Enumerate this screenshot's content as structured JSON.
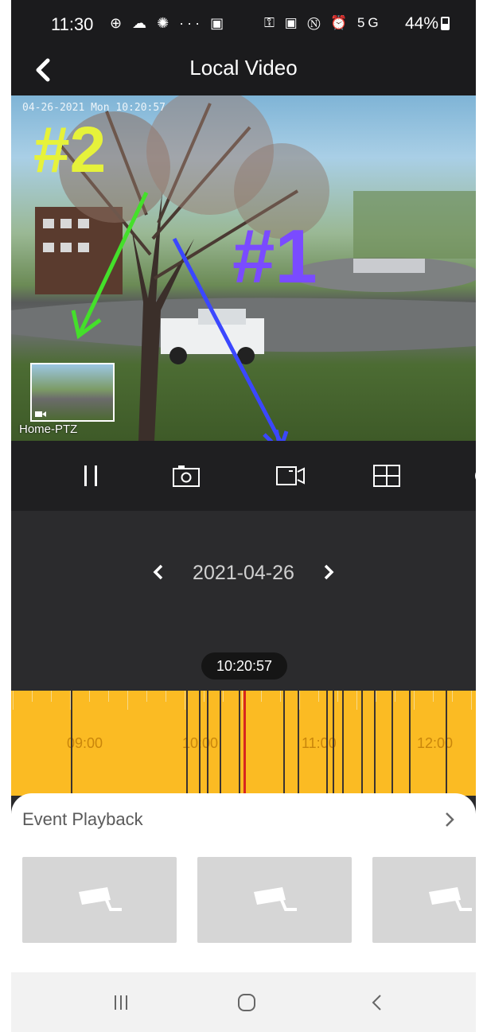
{
  "status_bar": {
    "time": "11:30",
    "left_icons": "⊕ ☁ ✺ ··· ▣",
    "right_icons": "⚿ ▣ Ⓝ ⏰ 5G ",
    "battery": "44%"
  },
  "header": {
    "title": "Local Video",
    "back_icon": "back-arrow-icon"
  },
  "video": {
    "timestamp": "04-26-2021  Mon 10:20:57",
    "pip_label": "Home-PTZ",
    "annotations": {
      "one": "#1",
      "two": "#2"
    },
    "annotation_colors": {
      "one": "#7a4bff",
      "two": "#e6f23a",
      "arrow_one": "#3b47ff",
      "arrow_two": "#44e02a"
    }
  },
  "controls": {
    "items": [
      "pause-icon",
      "snapshot-camera-icon",
      "record-video-icon",
      "grid-layout-icon"
    ]
  },
  "date_selector": {
    "date": "2021-04-26",
    "current_time": "10:20:57"
  },
  "timeline": {
    "labels": [
      "09:00",
      "10:00",
      "11:00",
      "12:00"
    ],
    "color": "#fbbb23",
    "cursor_color": "#d8261f"
  },
  "event_playback": {
    "title": "Event Playback",
    "more_icon": "chevron-right-icon",
    "thumbnails": [
      "camera-placeholder-icon",
      "camera-placeholder-icon",
      "camera-placeholder-icon"
    ]
  },
  "nav_bar": {
    "items": [
      "recent-apps-icon",
      "home-icon",
      "back-icon"
    ]
  }
}
